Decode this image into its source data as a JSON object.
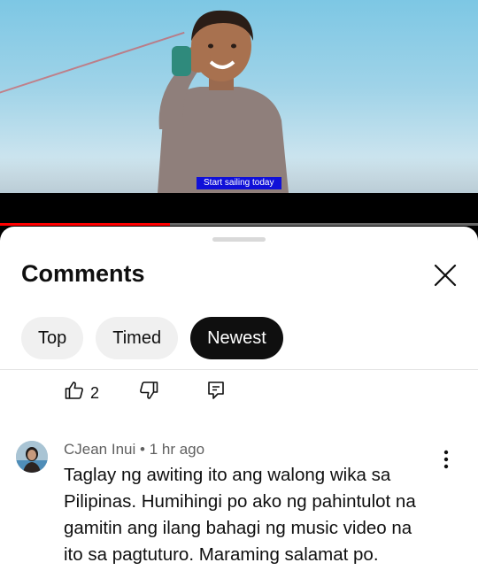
{
  "video": {
    "caption": "Start sailing today",
    "progress_fraction": 0.355
  },
  "comments_panel": {
    "title": "Comments",
    "close_icon": "close-icon",
    "chips": [
      {
        "label": "Top",
        "selected": false
      },
      {
        "label": "Timed",
        "selected": false
      },
      {
        "label": "Newest",
        "selected": true
      }
    ]
  },
  "previous_comment_actions": {
    "like_icon": "thumbs-up-icon",
    "like_count": "2",
    "dislike_icon": "thumbs-down-icon",
    "reply_icon": "reply-icon"
  },
  "comment": {
    "author": "CJean Inui",
    "separator": "•",
    "time": "1 hr ago",
    "text": "Taglay ng awiting ito ang walong wika sa Pilipinas. Humihingi po ako ng pahintulot na gamitin ang ilang bahagi ng music video na ito sa pagtuturo. Maraming salamat po.",
    "more_icon": "more-vert-icon"
  },
  "colors": {
    "progress_played": "#ff0000",
    "chip_active_bg": "#0f0f0f",
    "chip_bg": "#f0f0f0",
    "caption_bg": "#1010d8"
  }
}
